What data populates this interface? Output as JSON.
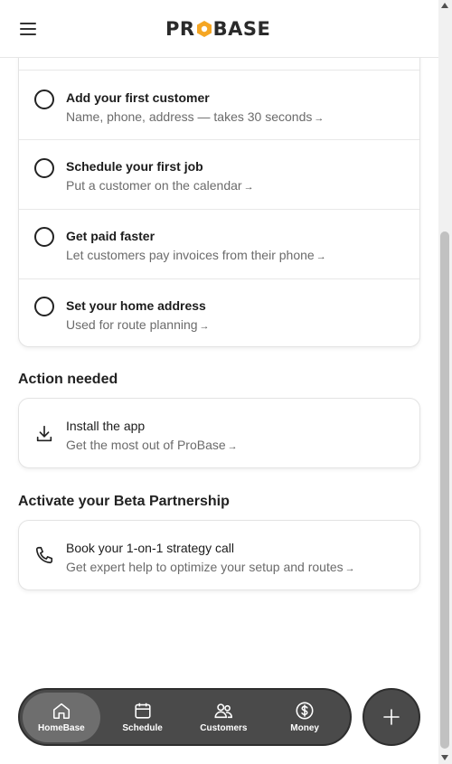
{
  "header": {
    "logo_text_left": "PR",
    "logo_text_right": "BASE",
    "logo_accent": "#f5a623"
  },
  "checklist": {
    "items": [
      {
        "title": "Add your first customer",
        "subtitle": "Name, phone, address — takes 30 seconds"
      },
      {
        "title": "Schedule your first job",
        "subtitle": "Put a customer on the calendar"
      },
      {
        "title": "Get paid faster",
        "subtitle": "Let customers pay invoices from their phone"
      },
      {
        "title": "Set your home address",
        "subtitle": "Used for route planning"
      }
    ],
    "arrow": "→"
  },
  "action_needed": {
    "heading": "Action needed",
    "title": "Install the app",
    "subtitle": "Get the most out of ProBase",
    "icon": "download-icon"
  },
  "beta": {
    "heading": "Activate your Beta Partnership",
    "title": "Book your 1-on-1 strategy call",
    "subtitle": "Get expert help to optimize your setup and routes",
    "icon": "phone-icon"
  },
  "nav": {
    "items": [
      {
        "label": "HomeBase",
        "icon": "home-icon",
        "active": true
      },
      {
        "label": "Schedule",
        "icon": "calendar-icon",
        "active": false
      },
      {
        "label": "Customers",
        "icon": "users-icon",
        "active": false
      },
      {
        "label": "Money",
        "icon": "dollar-icon",
        "active": false
      }
    ],
    "fab_icon": "plus-icon"
  },
  "colors": {
    "nav_bg": "#4a4a4a",
    "nav_active": "#6e6e6e",
    "accent": "#f5a623"
  }
}
